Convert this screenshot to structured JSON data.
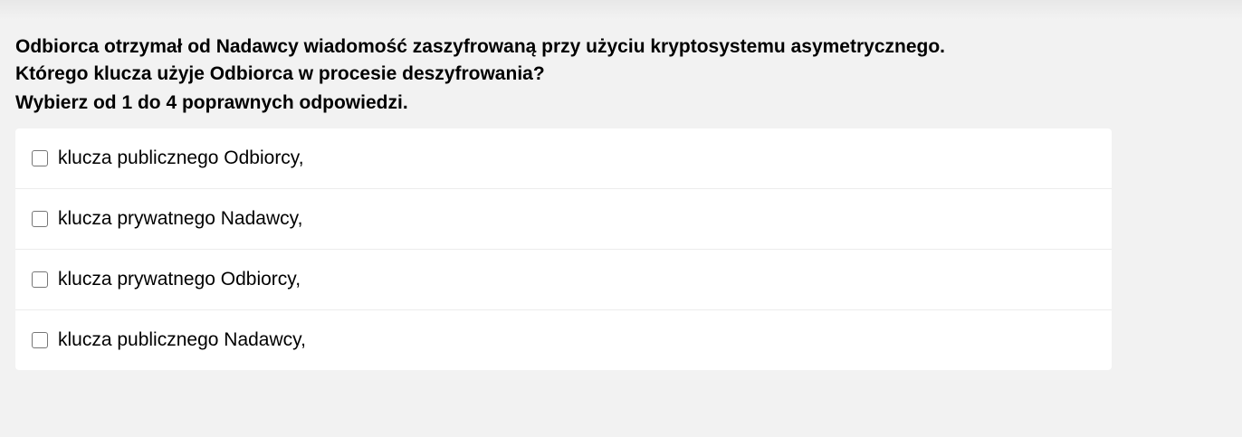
{
  "question": {
    "lines": [
      "Odbiorca otrzymał od Nadawcy wiadomość zaszyfrowaną przy użyciu kryptosystemu asymetrycznego.",
      "Którego klucza użyje Odbiorca w procesie deszyfrowania?"
    ],
    "instruction": "Wybierz od 1 do 4 poprawnych odpowiedzi."
  },
  "answers": [
    {
      "label": "klucza publicznego Odbiorcy,",
      "checked": false
    },
    {
      "label": "klucza prywatnego Nadawcy,",
      "checked": false
    },
    {
      "label": "klucza prywatnego Odbiorcy,",
      "checked": false
    },
    {
      "label": "klucza publicznego Nadawcy,",
      "checked": false
    }
  ]
}
